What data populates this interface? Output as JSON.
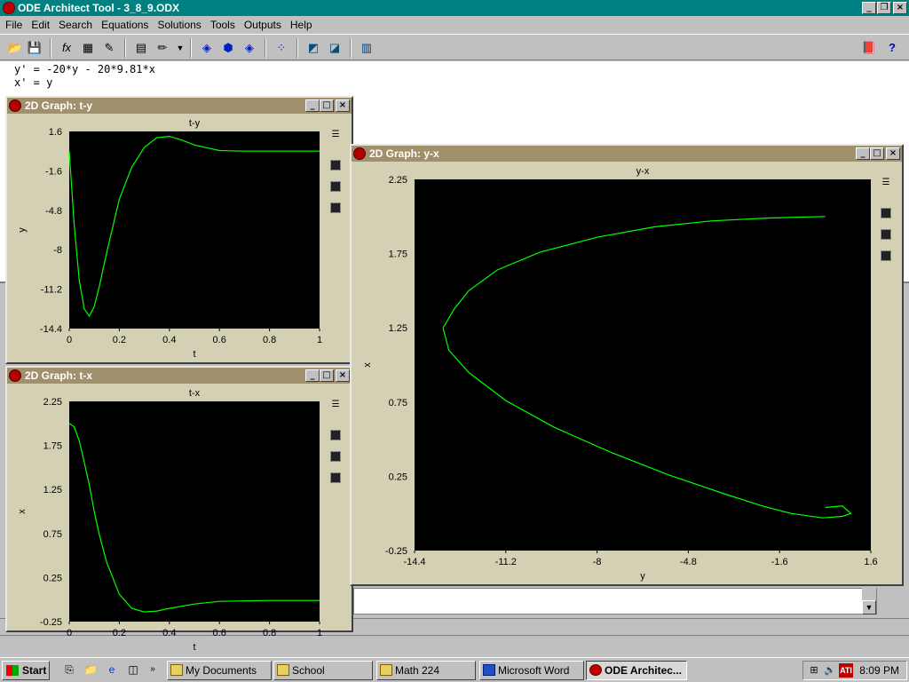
{
  "app": {
    "title": "ODE Architect Tool - 3_8_9.ODX"
  },
  "menu": [
    "File",
    "Edit",
    "Search",
    "Equations",
    "Solutions",
    "Tools",
    "Outputs",
    "Help"
  ],
  "toolbar_icons": [
    "open-icon",
    "save-icon",
    "function-icon",
    "table-icon",
    "edit-solutions-icon",
    "calculator-icon",
    "pencil-icon",
    "dropdown-icon",
    "graph-add-icon",
    "graph-3d-icon",
    "graph-multi-icon",
    "scatter-icon",
    "phase-icon",
    "animate-icon",
    "export-icon",
    "book-icon",
    "help-icon"
  ],
  "editor": {
    "lines": [
      "y' = -20*y - 20*9.81*x",
      "x' = y"
    ]
  },
  "graphs": {
    "ty": {
      "title": "2D Graph: t-y",
      "plot_title": "t-y",
      "xlabel": "t",
      "ylabel": "y",
      "xticks": [
        "0",
        "0.2",
        "0.4",
        "0.6",
        "0.8",
        "1"
      ],
      "yticks": [
        "1.6",
        "-1.6",
        "-4.8",
        "-8",
        "-11.2",
        "-14.4"
      ]
    },
    "tx": {
      "title": "2D Graph: t-x",
      "plot_title": "t-x",
      "xlabel": "t",
      "ylabel": "x",
      "xticks": [
        "0",
        "0.2",
        "0.4",
        "0.6",
        "0.8",
        "1"
      ],
      "yticks": [
        "2.25",
        "1.75",
        "1.25",
        "0.75",
        "0.25",
        "-0.25"
      ]
    },
    "yx": {
      "title": "2D Graph: y-x",
      "plot_title": "y-x",
      "xlabel": "y",
      "ylabel": "x",
      "xticks": [
        "-14.4",
        "-11.2",
        "-8",
        "-4.8",
        "-1.6",
        "1.6"
      ],
      "yticks": [
        "2.25",
        "1.75",
        "1.25",
        "0.75",
        "0.25",
        "-0.25"
      ]
    }
  },
  "chart_data": [
    {
      "type": "line",
      "title": "t-y",
      "xlabel": "t",
      "ylabel": "y",
      "xlim": [
        0,
        1
      ],
      "ylim": [
        -14.4,
        1.6
      ],
      "color": "#00ff00",
      "x": [
        0,
        0.02,
        0.04,
        0.06,
        0.08,
        0.1,
        0.12,
        0.15,
        0.2,
        0.25,
        0.3,
        0.35,
        0.4,
        0.45,
        0.5,
        0.6,
        0.7,
        0.8,
        0.9,
        1.0
      ],
      "y": [
        0,
        -6,
        -10.5,
        -12.8,
        -13.4,
        -12.6,
        -11,
        -8.2,
        -3.9,
        -1.3,
        0.3,
        1.1,
        1.2,
        0.9,
        0.5,
        0.05,
        0,
        0,
        0,
        0
      ]
    },
    {
      "type": "line",
      "title": "t-x",
      "xlabel": "t",
      "ylabel": "x",
      "xlim": [
        0,
        1
      ],
      "ylim": [
        -0.25,
        2.25
      ],
      "color": "#00ff00",
      "x": [
        0,
        0.02,
        0.04,
        0.06,
        0.08,
        0.1,
        0.12,
        0.15,
        0.2,
        0.25,
        0.3,
        0.35,
        0.4,
        0.5,
        0.6,
        0.8,
        1.0
      ],
      "y": [
        2,
        1.96,
        1.8,
        1.56,
        1.3,
        1.0,
        0.74,
        0.42,
        0.06,
        -0.1,
        -0.14,
        -0.13,
        -0.1,
        -0.05,
        -0.02,
        -0.01,
        -0.01
      ]
    },
    {
      "type": "line",
      "title": "y-x",
      "xlabel": "y",
      "ylabel": "x",
      "xlim": [
        -14.4,
        1.6
      ],
      "ylim": [
        -0.25,
        2.25
      ],
      "color": "#00ff00",
      "x": [
        0,
        -2,
        -4,
        -6,
        -8,
        -10,
        -11.5,
        -12.5,
        -13.0,
        -13.4,
        -13.2,
        -12.5,
        -11.2,
        -9.5,
        -7.5,
        -5.5,
        -3.5,
        -2.2,
        -1.2,
        -0.1,
        0.6,
        0.9,
        0.6,
        0
      ],
      "y": [
        2.0,
        1.99,
        1.97,
        1.93,
        1.86,
        1.76,
        1.64,
        1.5,
        1.38,
        1.25,
        1.1,
        0.95,
        0.76,
        0.58,
        0.41,
        0.26,
        0.13,
        0.05,
        0.0,
        -0.03,
        -0.02,
        0.0,
        0.05,
        0.04
      ]
    }
  ],
  "taskbar": {
    "start": "Start",
    "tasks": [
      "My Documents",
      "School",
      "Math 224",
      "Microsoft Word",
      "ODE Architec..."
    ],
    "clock": "8:09 PM"
  }
}
